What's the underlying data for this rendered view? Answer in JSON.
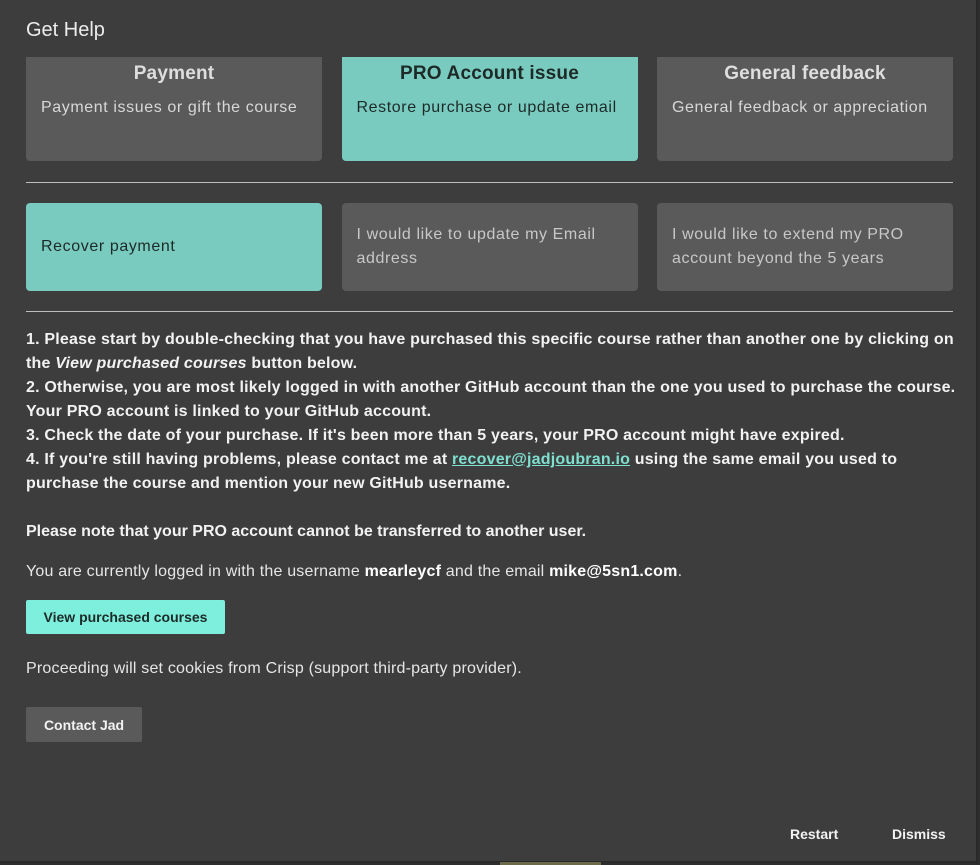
{
  "dialog": {
    "title": "Get Help"
  },
  "categories": [
    {
      "title": "Payment",
      "description": "Payment issues or gift the course",
      "selected": false
    },
    {
      "title": "PRO Account issue",
      "description": "Restore purchase or update email",
      "selected": true
    },
    {
      "title": "General feedback",
      "description": "General feedback or appreciation",
      "selected": false
    }
  ],
  "topics": [
    {
      "label": "Recover payment",
      "selected": true
    },
    {
      "label": "I would like to update my Email address",
      "selected": false
    },
    {
      "label": "I would like to extend my PRO account beyond the 5 years",
      "selected": false
    }
  ],
  "instructions": {
    "step1_before": "1. Please start by double-checking that you have purchased this specific course rather than another one by clicking on the ",
    "step1_emphasis": "View purchased courses",
    "step1_after": " button below.",
    "step2": "2. Otherwise, you are most likely logged in with another GitHub account than the one you used to purchase the course. Your PRO account is linked to your GitHub account.",
    "step3": "3. Check the date of your purchase. If it's been more than 5 years, your PRO account might have expired.",
    "step4_before": "4. If you're still having problems, please contact me at ",
    "step4_email": "recover@jadjoubran.io",
    "step4_after": " using the same email you used to purchase the course and mention your new GitHub username."
  },
  "note": "Please note that your PRO account cannot be transferred to another user.",
  "account": {
    "prefix": "You are currently logged in with the username ",
    "username": "mearleycf",
    "middle": " and the email ",
    "email": "mike@5sn1.com",
    "suffix": "."
  },
  "buttons": {
    "view_purchased": "View purchased courses",
    "contact": "Contact Jad",
    "restart": "Restart",
    "dismiss": "Dismiss"
  },
  "cookies_notice": "Proceeding will set cookies from Crisp (support third-party provider).",
  "colors": {
    "selected_card": "#79cbbf",
    "card": "#5a5a5a",
    "primary_button": "#7eeedd",
    "link": "#7fe0d0",
    "dialog_bg": "#3d3d3d"
  }
}
